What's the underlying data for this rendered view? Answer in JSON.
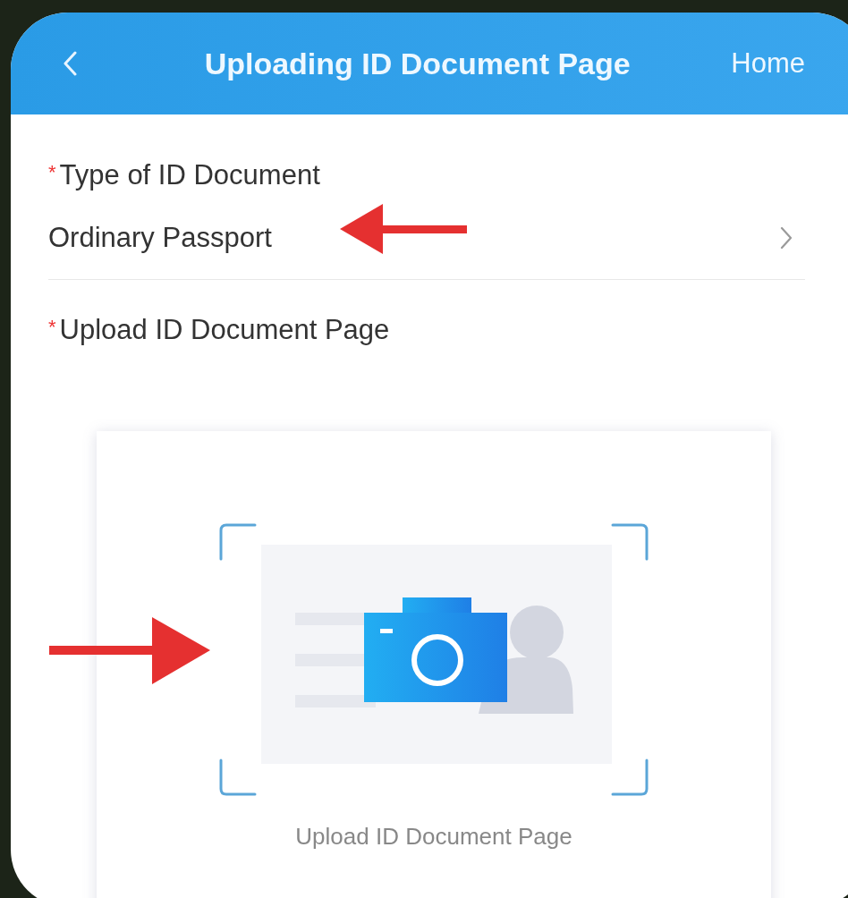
{
  "nav": {
    "title": "Uploading ID Document Page",
    "home": "Home"
  },
  "fields": [
    {
      "kind": "select",
      "required_mark": "*",
      "label": "Type of ID Document",
      "value": "Ordinary Passport"
    },
    {
      "kind": "upload",
      "required_mark": "*",
      "label": "Upload ID Document Page",
      "caption": "Upload ID Document Page"
    }
  ],
  "annotations": [
    {
      "kind": "left"
    },
    {
      "kind": "right"
    }
  ]
}
